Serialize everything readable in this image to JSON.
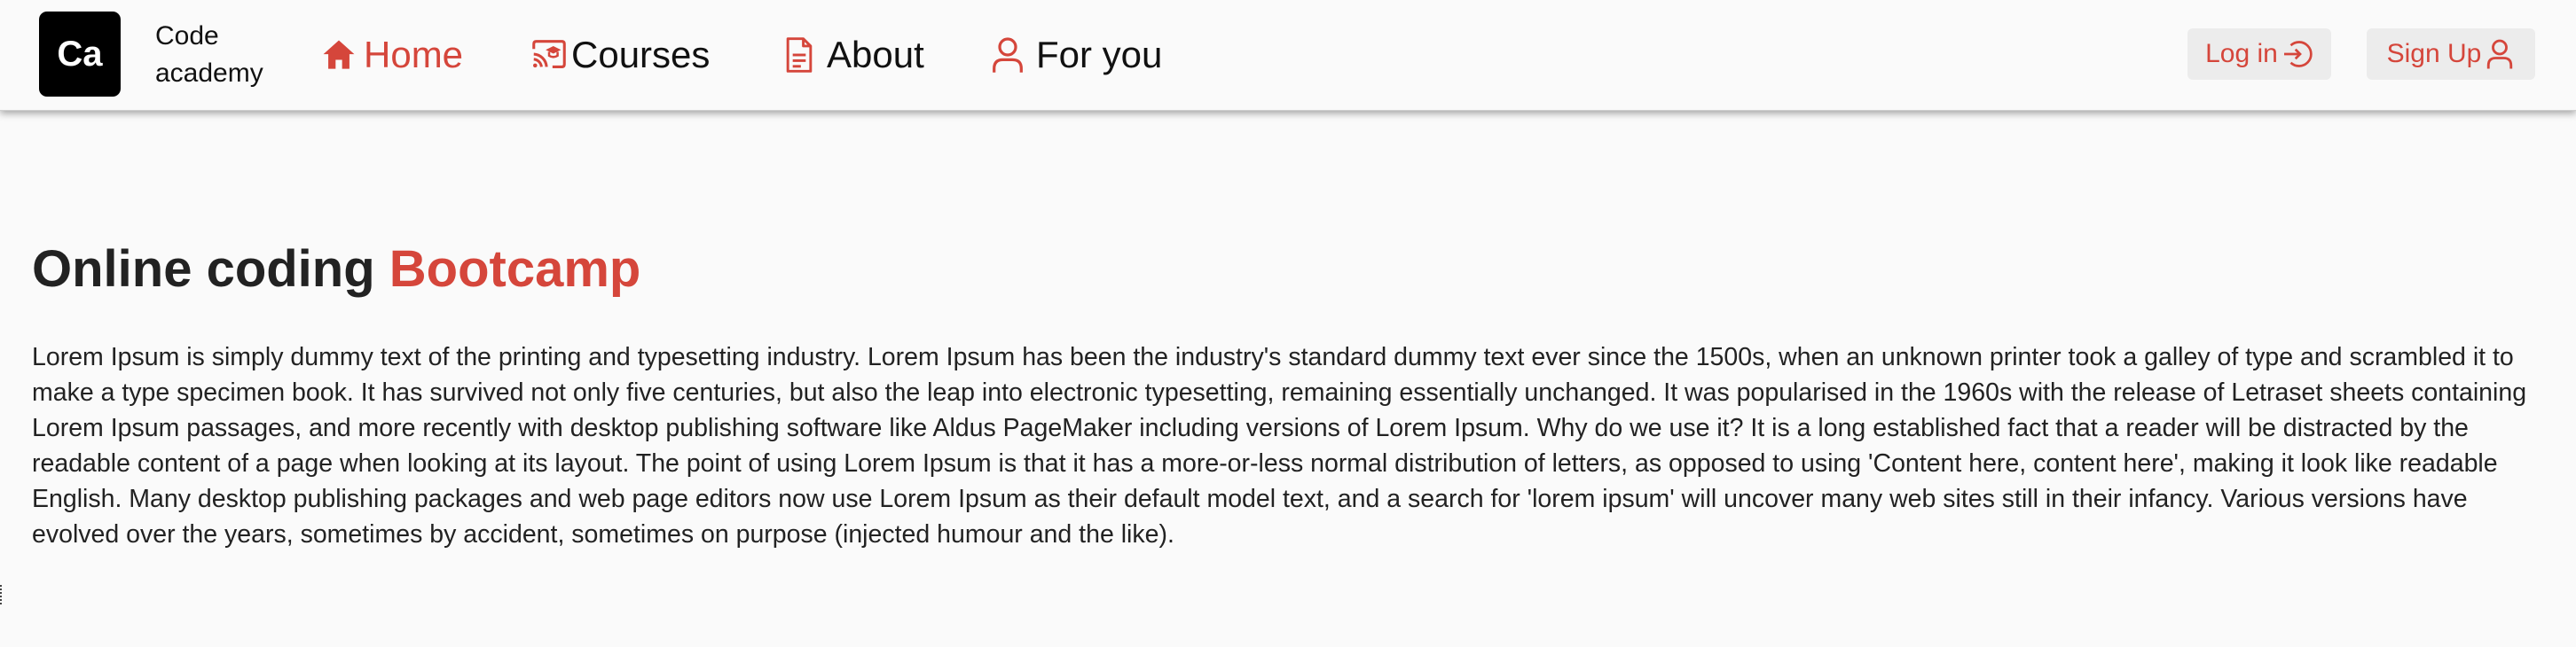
{
  "brand": {
    "logo_text": "Ca",
    "name": "Code academy"
  },
  "nav": {
    "items": [
      {
        "label": "Home",
        "icon": "home-icon",
        "active": true
      },
      {
        "label": "Courses",
        "icon": "cast-for-education-icon",
        "active": false
      },
      {
        "label": "About",
        "icon": "document-icon",
        "active": false
      },
      {
        "label": "For you",
        "icon": "person-icon",
        "active": false
      }
    ]
  },
  "auth": {
    "login_label": "Log in",
    "login_icon": "login-icon",
    "signup_label": "Sign Up",
    "signup_icon": "person-icon"
  },
  "hero": {
    "title_prefix": "Online coding ",
    "title_accent": "Bootcamp",
    "body": "Lorem Ipsum is simply dummy text of the printing and typesetting industry. Lorem Ipsum has been the industry's standard dummy text ever since the 1500s, when an unknown printer took a galley of type and scrambled it to make a type specimen book. It has survived not only five centuries, but also the leap into electronic typesetting, remaining essentially unchanged. It was popularised in the 1960s with the release of Letraset sheets containing Lorem Ipsum passages, and more recently with desktop publishing software like Aldus PageMaker including versions of Lorem Ipsum. Why do we use it? It is a long established fact that a reader will be distracted by the readable content of a page when looking at its layout. The point of using Lorem Ipsum is that it has a more-or-less normal distribution of letters, as opposed to using 'Content here, content here', making it look like readable English. Many desktop publishing packages and web page editors now use Lorem Ipsum as their default model text, and a search for 'lorem ipsum' will uncover many web sites still in their infancy. Various versions have evolved over the years, sometimes by accident, sometimes on purpose (injected humour and the like)."
  },
  "colors": {
    "accent": "#d5463b",
    "background": "#fafafa",
    "button_bg": "#ececec",
    "text": "#222222"
  }
}
